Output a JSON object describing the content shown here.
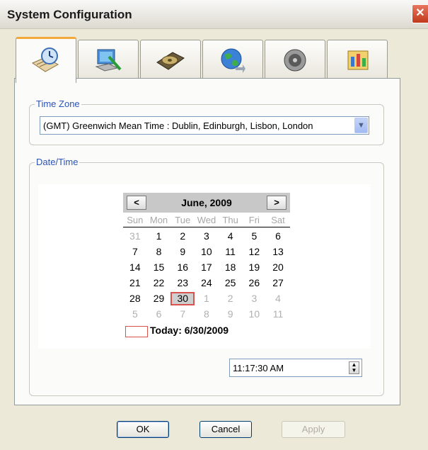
{
  "window": {
    "title": "System Configuration",
    "close_label": "✕"
  },
  "tabs": [
    {
      "icon": "date-time-icon",
      "active": true
    },
    {
      "icon": "display-icon",
      "active": false
    },
    {
      "icon": "hard-disk-icon",
      "active": false
    },
    {
      "icon": "network-globe-icon",
      "active": false
    },
    {
      "icon": "speaker-icon",
      "active": false
    },
    {
      "icon": "control-panel-icon",
      "active": false
    }
  ],
  "time_zone": {
    "label": "Time Zone",
    "value": "(GMT) Greenwich Mean Time : Dublin, Edinburgh, Lisbon, London"
  },
  "date_time": {
    "label": "Date/Time",
    "calendar": {
      "prev_label": "<",
      "next_label": ">",
      "month_title": "June, 2009",
      "days_of_week": [
        "Sun",
        "Mon",
        "Tue",
        "Wed",
        "Thu",
        "Fri",
        "Sat"
      ],
      "weeks": [
        [
          31,
          1,
          2,
          3,
          4,
          5,
          6
        ],
        [
          7,
          8,
          9,
          10,
          11,
          12,
          13
        ],
        [
          14,
          15,
          16,
          17,
          18,
          19,
          20
        ],
        [
          21,
          22,
          23,
          24,
          25,
          26,
          27
        ],
        [
          28,
          29,
          30,
          1,
          2,
          3,
          4
        ],
        [
          5,
          6,
          7,
          8,
          9,
          10,
          11
        ]
      ],
      "other_month": [
        [
          true,
          false,
          false,
          false,
          false,
          false,
          false
        ],
        [
          false,
          false,
          false,
          false,
          false,
          false,
          false
        ],
        [
          false,
          false,
          false,
          false,
          false,
          false,
          false
        ],
        [
          false,
          false,
          false,
          false,
          false,
          false,
          false
        ],
        [
          false,
          false,
          false,
          true,
          true,
          true,
          true
        ],
        [
          true,
          true,
          true,
          true,
          true,
          true,
          true
        ]
      ],
      "selected_day": 30,
      "today_label": "Today: 6/30/2009"
    },
    "time_value": "11:17:30 AM"
  },
  "buttons": {
    "ok": "OK",
    "cancel": "Cancel",
    "apply": "Apply"
  }
}
